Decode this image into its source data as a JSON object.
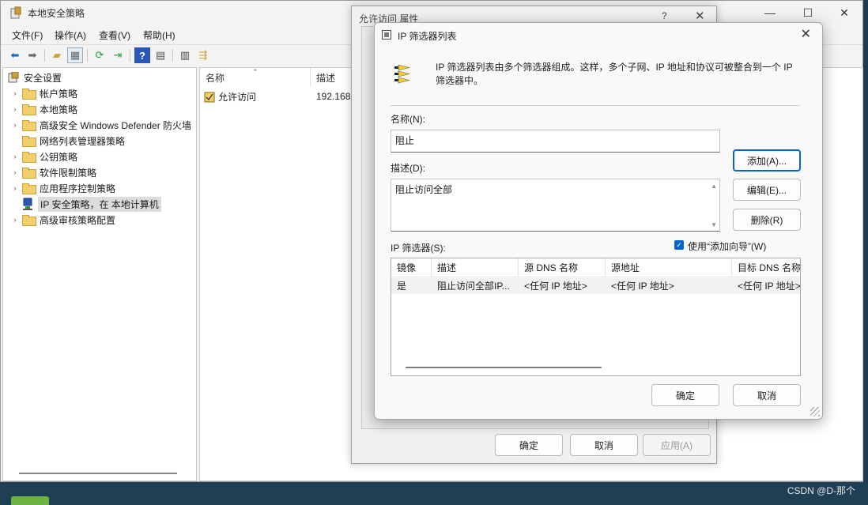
{
  "main": {
    "title": "本地安全策略",
    "menu": [
      "文件(F)",
      "操作(A)",
      "查看(V)",
      "帮助(H)"
    ],
    "tree": [
      {
        "label": "安全设置",
        "expand": "⌄",
        "icon": "shield-icon"
      },
      {
        "label": "帐户策略",
        "expand": "›",
        "icon": "folder-icon"
      },
      {
        "label": "本地策略",
        "expand": "›",
        "icon": "folder-icon"
      },
      {
        "label": "高级安全 Windows Defender 防火墙",
        "expand": "›",
        "icon": "folder-icon"
      },
      {
        "label": "网络列表管理器策略",
        "expand": "",
        "icon": "folder-icon"
      },
      {
        "label": "公钥策略",
        "expand": "›",
        "icon": "folder-icon"
      },
      {
        "label": "软件限制策略",
        "expand": "›",
        "icon": "folder-icon"
      },
      {
        "label": "应用程序控制策略",
        "expand": "›",
        "icon": "folder-icon"
      },
      {
        "label": "IP 安全策略，在 本地计算机",
        "expand": "",
        "icon": "ip-policy-icon"
      },
      {
        "label": "高级审核策略配置",
        "expand": "›",
        "icon": "folder-icon"
      }
    ],
    "list": {
      "col_name": "名称",
      "col_desc": "描述",
      "row_name": "允许访问",
      "row_desc": "192.168"
    }
  },
  "prop_dialog": {
    "title": "允许访问 属性",
    "ok": "确定",
    "cancel": "取消",
    "apply": "应用(A)"
  },
  "filter_dialog": {
    "title": "IP 筛选器列表",
    "description": "IP 筛选器列表由多个筛选器组成。这样，多个子网、IP 地址和协议可被整合到一个 IP 筛选器中。",
    "name_label": "名称(N):",
    "name_value": "阻止",
    "desc_label": "描述(D):",
    "desc_value": "阻止访问全部",
    "add": "添加(A)...",
    "edit": "编辑(E)...",
    "remove": "删除(R)",
    "filters_label": "IP 筛选器(S):",
    "wizard_label": "使用“添加向导”(W)",
    "wizard_checked": true,
    "columns": [
      "镜像",
      "描述",
      "源 DNS 名称",
      "源地址",
      "目标 DNS 名称"
    ],
    "rows": [
      [
        "是",
        "阻止访问全部IP...",
        "<任何 IP 地址>",
        "<任何 IP 地址>",
        "<任何 IP 地址>"
      ]
    ],
    "ok": "确定",
    "cancel": "取消"
  },
  "watermark": "CSDN @D-那个"
}
